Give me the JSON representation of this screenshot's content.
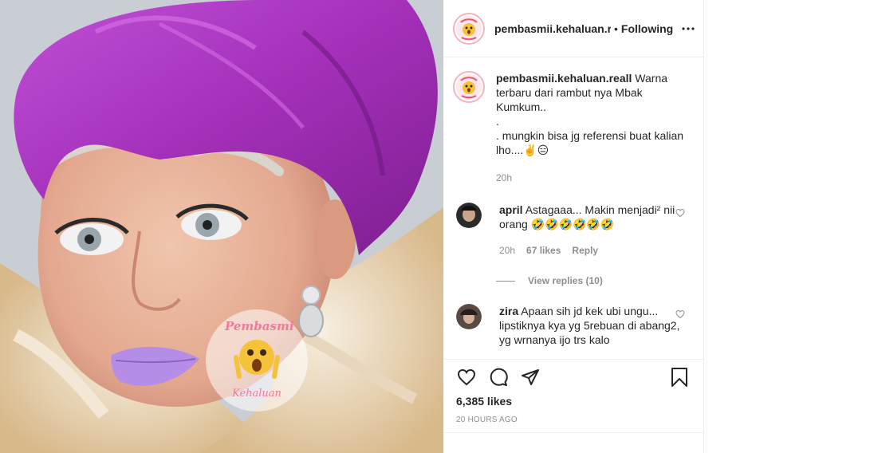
{
  "post": {
    "username": "pembasmii.kehaluan.reall",
    "header_username": "pembasmii.kehaluan.re",
    "dot": "•",
    "follow_state": "Following",
    "watermark_text_top": "Pembasmi",
    "watermark_text_bottom": "Kehaluan"
  },
  "caption": {
    "username": "pembasmii.kehaluan.reall",
    "text_line1": " Warna terbaru dari rambut nya Mbak Kumkum..",
    "text_line2": ".",
    "text_line3": ". mungkin bisa jg referensi buat kalian lho....✌️😑",
    "time": "20h"
  },
  "comments": [
    {
      "username": "april",
      "text": " Astagaaa... Makin menjadi² nii orang 🤣🤣🤣🤣🤣🤣",
      "time": "20h",
      "likes": "67 likes",
      "reply_label": "Reply",
      "view_replies": "View replies (10)"
    },
    {
      "username": "zira",
      "text": " Apaan sih jd kek ubi ungu... lipstiknya kya yg 5rebuan di abang2, yg wrnanya ijo trs kalo"
    }
  ],
  "footer": {
    "likes": "6,385 likes",
    "posted": "20 HOURS AGO"
  },
  "icons": {
    "more": "more-horizontal-icon",
    "like": "heart-icon",
    "comment": "comment-icon",
    "share": "share-icon",
    "save": "bookmark-icon",
    "comment_like": "small-heart-icon"
  },
  "colors": {
    "hair": "#a83ac2",
    "lips": "#b58de6",
    "text_primary": "#262626",
    "text_secondary": "#8e8e8e",
    "border": "#efefef"
  }
}
